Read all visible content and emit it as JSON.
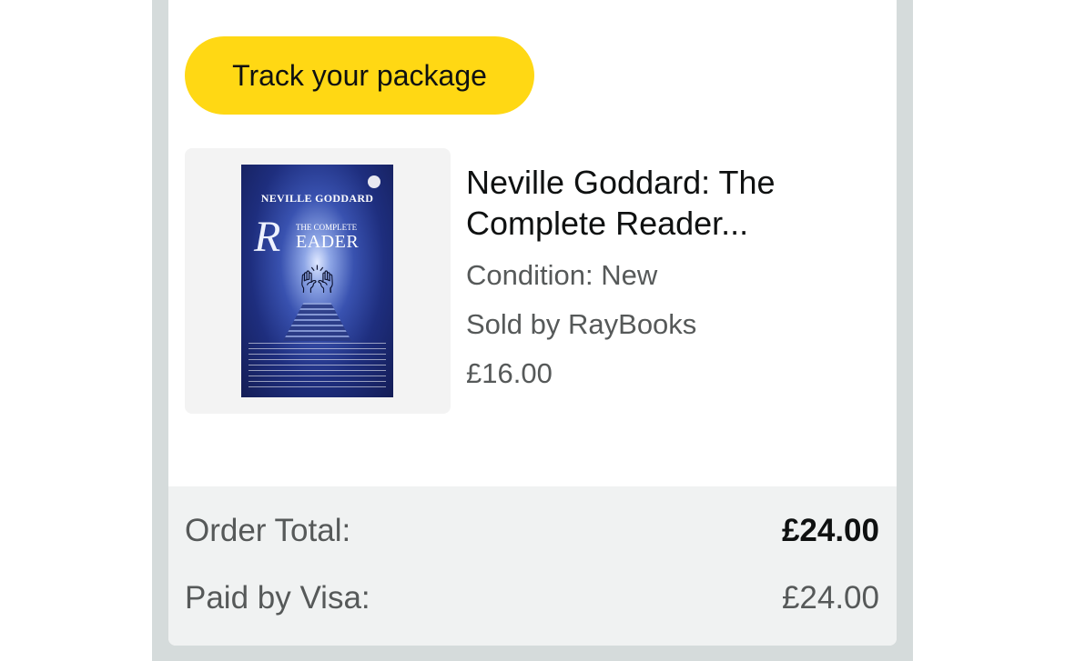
{
  "actions": {
    "track_label": "Track your package"
  },
  "item": {
    "cover": {
      "author": "NEVILLE GODDARD",
      "subtitle": "THE COMPLETE",
      "title_initial": "R",
      "title_rest": "EADER"
    },
    "title_line1": "Neville Goddard: The",
    "title_line2": "Complete Reader...",
    "condition": "Condition: New",
    "seller": "Sold by RayBooks",
    "price": "£16.00"
  },
  "totals": {
    "order_total_label": "Order Total:",
    "order_total_value": "£24.00",
    "paid_label": "Paid by Visa:",
    "paid_value": "£24.00"
  },
  "colors": {
    "track_button": "#ffd814",
    "frame": "#d5dbdb",
    "totals_bg": "#f0f2f2",
    "text_primary": "#0f1111",
    "text_secondary": "#565959"
  }
}
